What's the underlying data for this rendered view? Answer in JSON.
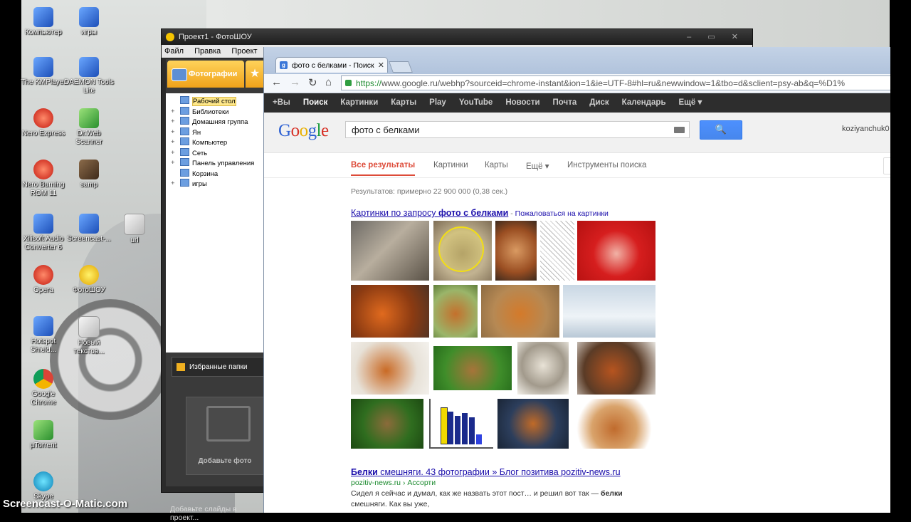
{
  "desktop": {
    "icons": [
      {
        "label": "Компьютер",
        "glyph": "g-blue",
        "icon": "computer-icon"
      },
      {
        "label": "игры",
        "glyph": "g-blue",
        "icon": "games-folder-icon"
      },
      {
        "label": "The KMPlayer",
        "glyph": "g-blue",
        "icon": "kmplayer-icon"
      },
      {
        "label": "DAEMON Tools Lite",
        "glyph": "g-blue",
        "icon": "daemon-tools-icon"
      },
      {
        "label": "Nero Express",
        "glyph": "g-red",
        "icon": "nero-express-icon"
      },
      {
        "label": "Dr.Web Scanner",
        "glyph": "g-green",
        "icon": "drweb-icon"
      },
      {
        "label": "Nero Burning ROM 11",
        "glyph": "g-red",
        "icon": "nero-burning-icon"
      },
      {
        "label": "samp",
        "glyph": "g-dark",
        "icon": "samp-icon"
      },
      {
        "label": "Xilisoft Audio Converter 6",
        "glyph": "g-blue",
        "icon": "xilisoft-icon"
      },
      {
        "label": "Screencast-...",
        "glyph": "g-blue",
        "icon": "screencast-icon"
      },
      {
        "label": "url",
        "glyph": "g-gray",
        "icon": "url-icon"
      },
      {
        "label": "Opera",
        "glyph": "g-red",
        "icon": "opera-icon"
      },
      {
        "label": "ФотоШОУ",
        "glyph": "g-yellow",
        "icon": "fotoshow-icon"
      },
      {
        "label": "Hotspot Shield...",
        "glyph": "g-blue",
        "icon": "hotspot-shield-icon"
      },
      {
        "label": "Новый текстов...",
        "glyph": "g-gray",
        "icon": "text-document-icon"
      },
      {
        "label": "Google Chrome",
        "glyph": "g-chrome",
        "icon": "chrome-icon"
      },
      {
        "label": "µTorrent",
        "glyph": "g-green",
        "icon": "utorrent-icon"
      },
      {
        "label": "Skype",
        "glyph": "g-teal",
        "icon": "skype-icon"
      }
    ],
    "watermark": "Screencast-O-Matic.com"
  },
  "fotoshow": {
    "title": "Проект1 - ФотоШОУ",
    "window_controls": "‒ ▭ ✕",
    "menu": [
      "Файл",
      "Правка",
      "Проект"
    ],
    "tab_photos": "Фотографии",
    "tab_star": "★",
    "tree": [
      {
        "label": "Рабочий стол",
        "selected": true,
        "expander": ""
      },
      {
        "label": "Библиотеки",
        "selected": false,
        "expander": "+"
      },
      {
        "label": "Домашняя группа",
        "selected": false,
        "expander": "+"
      },
      {
        "label": "Ян",
        "selected": false,
        "expander": "+"
      },
      {
        "label": "Компьютер",
        "selected": false,
        "expander": "+"
      },
      {
        "label": "Сеть",
        "selected": false,
        "expander": "+"
      },
      {
        "label": "Панель управления",
        "selected": false,
        "expander": "+"
      },
      {
        "label": "Корзина",
        "selected": false,
        "expander": ""
      },
      {
        "label": "игры",
        "selected": false,
        "expander": "+"
      }
    ],
    "favorites": "Избранные папки",
    "add_photo": "Добавьте фото",
    "add_slides": "Добавьте слайды в проект..."
  },
  "chrome": {
    "tab_title": "фото с белками - Поиск",
    "tab_favicon": "g",
    "tab_close": "✕",
    "nav": {
      "back": "←",
      "forward": "→",
      "reload": "↻",
      "home": "⌂"
    },
    "url_https": "https://",
    "url_rest": "www.google.ru/webhp?sourceid=chrome-instant&ion=1&ie=UTF-8#hl=ru&newwindow=1&tbo=d&sclient=psy-ab&q=%D1%",
    "gbar": [
      "+Вы",
      "Поиск",
      "Картинки",
      "Карты",
      "Play",
      "YouTube",
      "Новости",
      "Почта",
      "Диск",
      "Календарь",
      "Ещё ▾"
    ],
    "gbar_active": 1,
    "logo": [
      "G",
      "o",
      "o",
      "g",
      "l",
      "e"
    ],
    "query": "фото с белками",
    "search_button": "🔍",
    "user": "koziyanchuk0",
    "tabs": [
      "Все результаты",
      "Картинки",
      "Карты",
      "Ещё ▾",
      "Инструменты поиска"
    ],
    "stats": "Результатов: примерно 22 900 000 (0,38 сек.)",
    "images_header": {
      "prefix": "Картинки по запросу ",
      "query": "фото с белками",
      "dash": " - ",
      "report": "Пожаловаться на картинки"
    },
    "result": {
      "title_bold": "Белки",
      "title_rest": " смешняги. 43 фотографии » Блог позитива pozitiv-news.ru",
      "url": "pozitiv-news.ru › Ассорти",
      "snippet_1": "Сидел я сейчас и думал, как же назвать этот пост… и решил вот так — ",
      "snippet_bold": "белки",
      "snippet_2": "смешняги. Как вы уже,"
    }
  }
}
